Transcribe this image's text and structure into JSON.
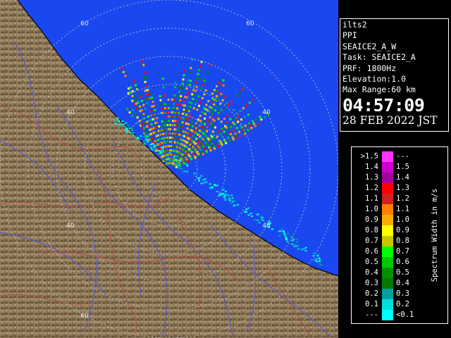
{
  "station": {
    "name": "ilts2",
    "product": "PPI",
    "scan": "SEAICE2_A_W",
    "task": "Task: SEAICE2_A",
    "prf": "PRF: 1800Hz",
    "elevation": "Elevation:1.0",
    "max_range": "Max Range:60 km",
    "time": "04:57:09",
    "date": "28 FEB 2022 JST"
  },
  "map": {
    "range_labels": [
      "60",
      "60",
      "40",
      "40",
      "40",
      "40",
      "60"
    ],
    "colors": {
      "sea": "#1a48f0",
      "land": "#8a7556",
      "river": "#5a5ac8",
      "boundary": "#b04a40",
      "rings": "#c0c0c0"
    }
  },
  "legend": {
    "title": "Spectrum Width in m/s",
    "rows": [
      {
        "low": ">1.5",
        "high": "---",
        "color": "#ff33ff"
      },
      {
        "low": "1.4",
        "high": "1.5",
        "color": "#cc00cc"
      },
      {
        "low": "1.3",
        "high": "1.4",
        "color": "#a000a0"
      },
      {
        "low": "1.2",
        "high": "1.3",
        "color": "#ff0000"
      },
      {
        "low": "1.1",
        "high": "1.2",
        "color": "#d02020"
      },
      {
        "low": "1.0",
        "high": "1.1",
        "color": "#ff8000"
      },
      {
        "low": "0.9",
        "high": "1.0",
        "color": "#ffaa00"
      },
      {
        "low": "0.8",
        "high": "0.9",
        "color": "#ffff00"
      },
      {
        "low": "0.7",
        "high": "0.8",
        "color": "#c8c800"
      },
      {
        "low": "0.6",
        "high": "0.7",
        "color": "#00ff00"
      },
      {
        "low": "0.5",
        "high": "0.6",
        "color": "#00c800"
      },
      {
        "low": "0.4",
        "high": "0.5",
        "color": "#009000"
      },
      {
        "low": "0.3",
        "high": "0.4",
        "color": "#007a00"
      },
      {
        "low": "0.2",
        "high": "0.3",
        "color": "#00a0a0"
      },
      {
        "low": "0.1",
        "high": "0.2",
        "color": "#00dddd"
      },
      {
        "low": "---",
        "high": "<0.1",
        "color": "#00ffff"
      }
    ]
  }
}
